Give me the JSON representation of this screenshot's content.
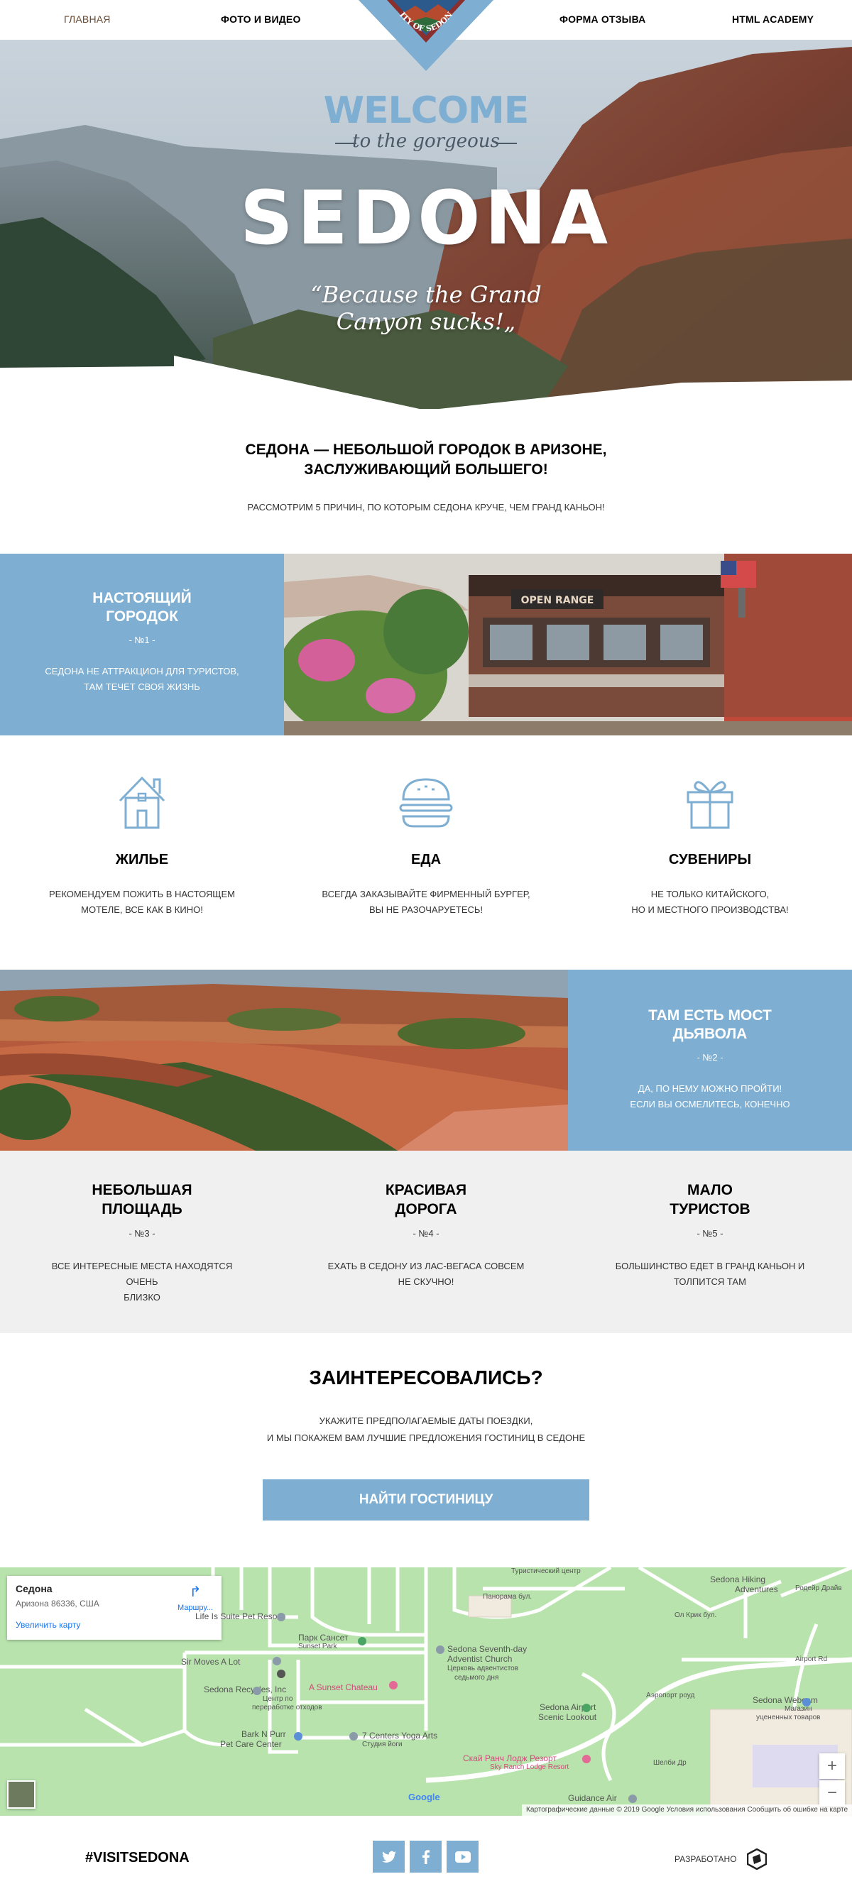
{
  "nav": {
    "items": [
      "Главная",
      "Фото и видео",
      "Форма отзыва",
      "HTML Academy"
    ],
    "logo_text": "CITY OF SEDONA"
  },
  "hero": {
    "welcome": "WELCOME",
    "subtitle": "to the gorgeous",
    "title": "SEDONA",
    "quote_line1": "“Because the Grand",
    "quote_line2": "Canyon sucks!„"
  },
  "intro": {
    "title_line1": "Седона — небольшой городок в Аризоне,",
    "title_line2": "заслуживающий большего!",
    "subtitle": "Рассмотрим 5 причин, по которым Седона круче, чем Гранд Каньон!"
  },
  "feature1": {
    "title_line1": "Настоящий",
    "title_line2": "городок",
    "num": "- №1 -",
    "text_line1": "Седона не аттракцион для туристов,",
    "text_line2": "там течет своя жизнь",
    "sign_text": "OPEN RANGE"
  },
  "columns": [
    {
      "title": "Жилье",
      "text_line1": "Рекомендуем пожить в настоящем",
      "text_line2": "мотеле, все как в кино!"
    },
    {
      "title": "Еда",
      "text_line1": "Всегда заказывайте фирменный бургер,",
      "text_line2": "вы не разочаруетесь!"
    },
    {
      "title": "Сувениры",
      "text_line1": "Не только китайского,",
      "text_line2": "но и местного производства!"
    }
  ],
  "feature2": {
    "title_line1": "Там есть мост",
    "title_line2": "дьявола",
    "num": "- №2 -",
    "text_line1": "Да, по нему можно пройти!",
    "text_line2": "Если вы осмелитесь, конечно"
  },
  "reasons": [
    {
      "title_line1": "Небольшая",
      "title_line2": "площадь",
      "num": "- №3 -",
      "text_line1": "Все интересные места находятся очень",
      "text_line2": "близко"
    },
    {
      "title_line1": "Красивая",
      "title_line2": "дорога",
      "num": "- №4 -",
      "text_line1": "Ехать в Седону из Лас-Вегаса совсем",
      "text_line2": "не скучно!"
    },
    {
      "title_line1": "Мало",
      "title_line2": "туристов",
      "num": "- №5 -",
      "text_line1": "Большинство едет в Гранд Каньон и",
      "text_line2": "толпится там"
    }
  ],
  "interested": {
    "title": "Заинтересовались?",
    "text_line1": "Укажите предполагаемые даты поездки,",
    "text_line2": "и мы покажем вам лучшие предложения гостиниц в Седоне",
    "button": "Найти гостиницу"
  },
  "map": {
    "place": "Седона",
    "address": "Аризона 86336, США",
    "route": "Маршру...",
    "enlarge": "Увеличить карту",
    "zoom_in": "+",
    "zoom_out": "−",
    "footer_text": "Картографические данные © 2019 Google    Условия использования    Сообщить об ошибке на карте",
    "google": "Google",
    "labels": {
      "suite": "Life Is Suite Pet Resort",
      "park": "Парк Сансет",
      "park_en": "Sunset Park",
      "church": "Sedona Seventh-day",
      "church2": "Adventist Church",
      "church_ru": "Церковь адвентистов",
      "church_ru2": "седьмого дня",
      "moves": "Sir Moves A Lot",
      "recycles": "Sedona Recycles, Inc",
      "recycles_ru": "Центр по",
      "recycles_ru2": "переработке отходов",
      "chateau": "A Sunset Chateau",
      "bark": "Bark N Purr",
      "bark2": "Pet Care Center",
      "yoga": "7 Centers Yoga Arts",
      "yoga_ru": "Студия йоги",
      "airport": "Sedona Airport",
      "airport2": "Scenic Lookout",
      "lodge": "Скай Ранч Лодж Резорт",
      "lodge_en": "Sky Ranch Lodge Resort",
      "webcam": "Sedona Webcam",
      "webcam2": "Магазин",
      "webcam3": "уцененных товаров",
      "guidance": "Guidance Air",
      "tourist": "Туристический центр",
      "adventures": "Sedona Hiking",
      "adventures2": "Adventures",
      "panorama": "Панорама бул.",
      "krik": "Ол Крик бул.",
      "airport_rd": "Airport Rd",
      "airport_rd_ru": "Аэропорт роуд",
      "shelby": "Шелби Др",
      "rodear": "Родейр Драйв"
    }
  },
  "footer": {
    "hashtag": "#VISITSEDONA",
    "developed": "Разработано"
  },
  "colors": {
    "accent": "#7eaed1",
    "gray_band": "#f0f0f0",
    "map_green": "#b8e3ad"
  }
}
